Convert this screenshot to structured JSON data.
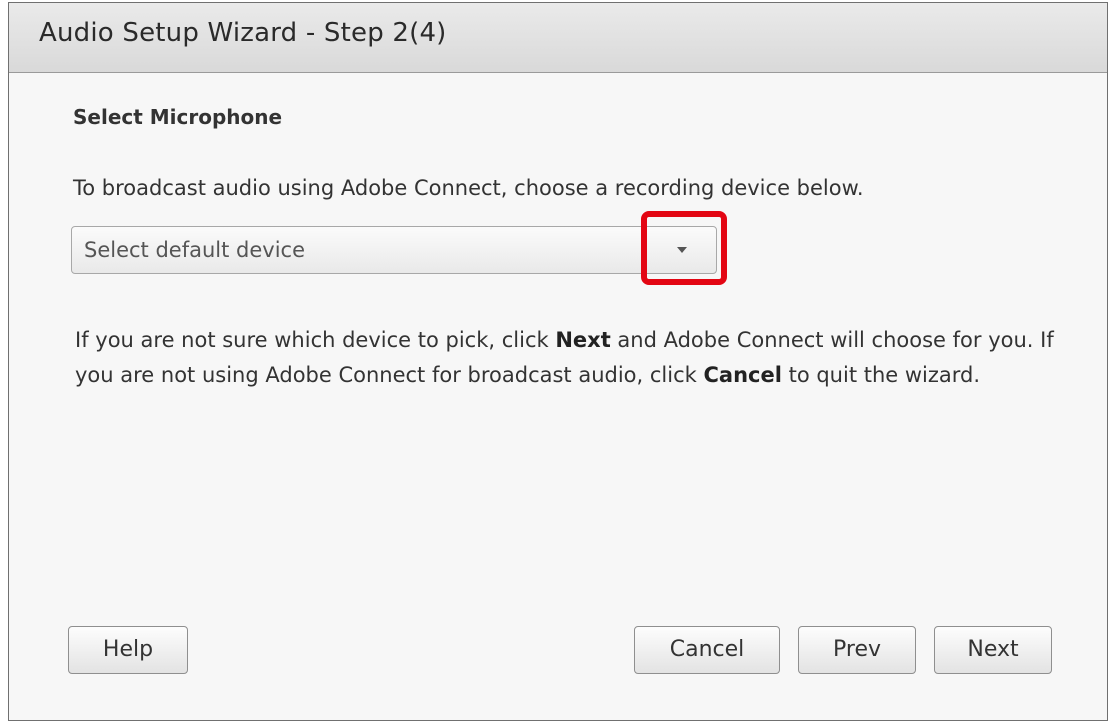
{
  "window": {
    "title": "Audio Setup Wizard - Step 2(4)"
  },
  "main": {
    "heading": "Select Microphone",
    "intro": "To broadcast audio using Adobe Connect, choose a recording device below.",
    "device_select": {
      "value": "Select default device",
      "dropdown_icon": "chevron-down-icon"
    },
    "info": {
      "part1": "If you are not sure which device to pick, click ",
      "next_word": "Next",
      "part2": " and Adobe Connect will choose for you. If you are not using Adobe Connect for broadcast audio, click ",
      "cancel_word": "Cancel",
      "part3": " to quit the wizard."
    }
  },
  "buttons": {
    "help": "Help",
    "cancel": "Cancel",
    "prev": "Prev",
    "next": "Next"
  },
  "colors": {
    "highlight": "#e30613",
    "background": "#f7f7f7"
  }
}
